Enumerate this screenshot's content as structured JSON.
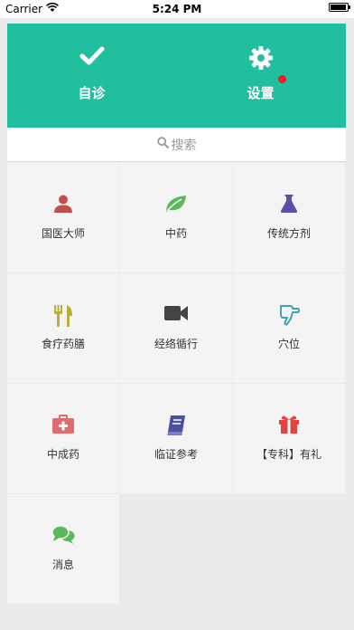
{
  "status_bar": {
    "carrier": "Carrier",
    "time": "5:24 PM"
  },
  "header": {
    "background": "#20bf9f",
    "items": [
      {
        "label": "自诊",
        "icon": "checkmark-icon"
      },
      {
        "label": "设置",
        "icon": "gear-icon",
        "has_notification": true
      }
    ]
  },
  "search": {
    "placeholder": "搜索",
    "icon": "search-icon"
  },
  "grid": {
    "items": [
      {
        "label": "国医大师",
        "icon": "person-icon",
        "color": "#c0504d"
      },
      {
        "label": "中药",
        "icon": "leaf-icon",
        "color": "#5cb85c"
      },
      {
        "label": "传统方剂",
        "icon": "flask-icon",
        "color": "#5b4fa8"
      },
      {
        "label": "食疗药膳",
        "icon": "fork-knife-icon",
        "color": "#b8b03a"
      },
      {
        "label": "经络循行",
        "icon": "video-camera-icon",
        "color": "#444444"
      },
      {
        "label": "穴位",
        "icon": "pointing-hand-icon",
        "color": "#3aa6b0"
      },
      {
        "label": "中成药",
        "icon": "medical-kit-icon",
        "color": "#e06b6b"
      },
      {
        "label": "临证参考",
        "icon": "book-icon",
        "color": "#4a4fa0"
      },
      {
        "label": "【专科】有礼",
        "icon": "gift-icon",
        "color": "#e0443c"
      },
      {
        "label": "消息",
        "icon": "chat-bubbles-icon",
        "color": "#5cb85c"
      }
    ]
  }
}
